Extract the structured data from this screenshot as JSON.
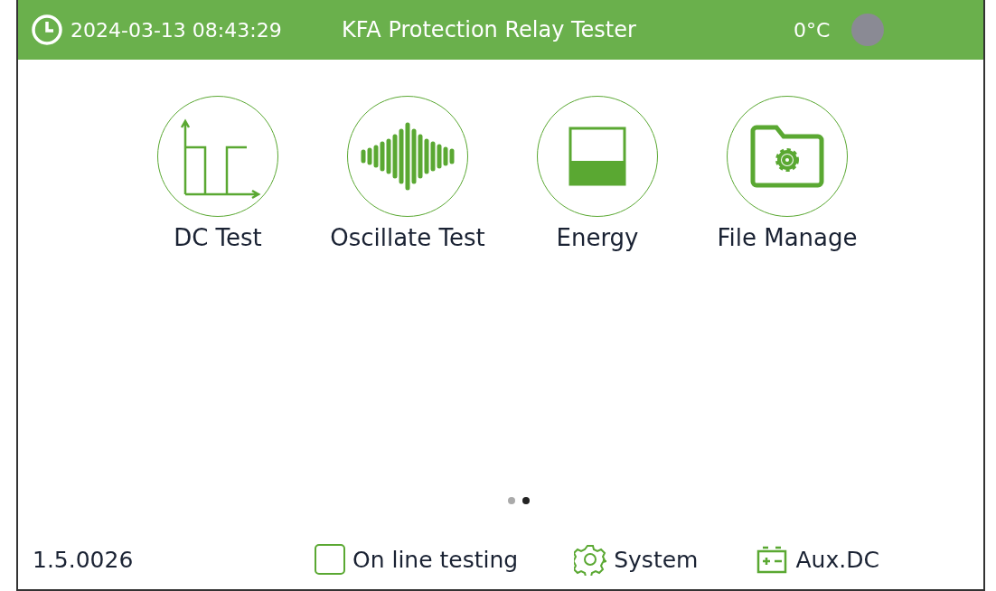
{
  "header": {
    "datetime": "2024-03-13 08:43:29",
    "title": "KFA Protection Relay Tester",
    "temperature": "0°C"
  },
  "apps": [
    {
      "kind": "dc",
      "label": "DC Test"
    },
    {
      "kind": "wave",
      "label": "Oscillate Test"
    },
    {
      "kind": "energy",
      "label": "Energy"
    },
    {
      "kind": "folder",
      "label": "File Manage"
    }
  ],
  "pages": [
    {
      "selected": false
    },
    {
      "selected": true
    }
  ],
  "footer": {
    "version": "1.5.0026",
    "online_testing": {
      "label": "On line testing",
      "checked": false
    },
    "system": "System",
    "aux_dc": "Aux.DC"
  }
}
